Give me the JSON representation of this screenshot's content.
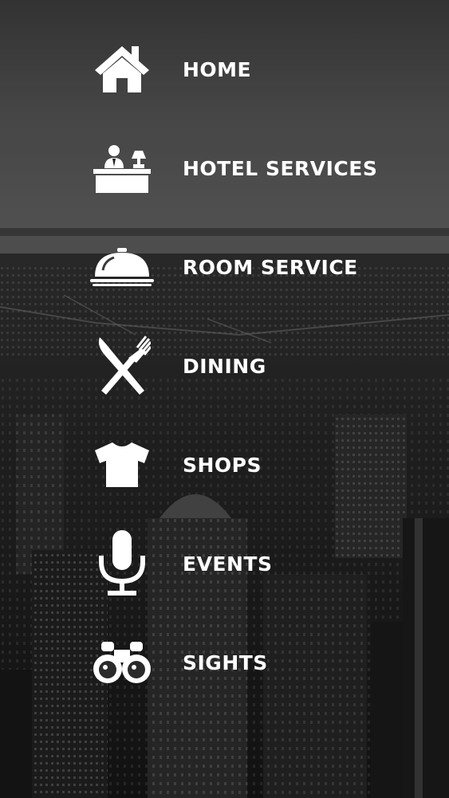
{
  "menu": {
    "items": [
      {
        "label": "HOME",
        "icon": "home-icon"
      },
      {
        "label": "HOTEL SERVICES",
        "icon": "front-desk-icon"
      },
      {
        "label": "ROOM SERVICE",
        "icon": "cloche-icon"
      },
      {
        "label": "DINING",
        "icon": "fork-knife-icon"
      },
      {
        "label": "SHOPS",
        "icon": "t-shirt-icon"
      },
      {
        "label": "EVENTS",
        "icon": "microphone-icon"
      },
      {
        "label": "SIGHTS",
        "icon": "binoculars-icon"
      }
    ]
  },
  "colors": {
    "text": "#ffffff",
    "icon": "#ffffff",
    "sky_top": "#4a4a4a",
    "city": "#1a1a1a"
  }
}
